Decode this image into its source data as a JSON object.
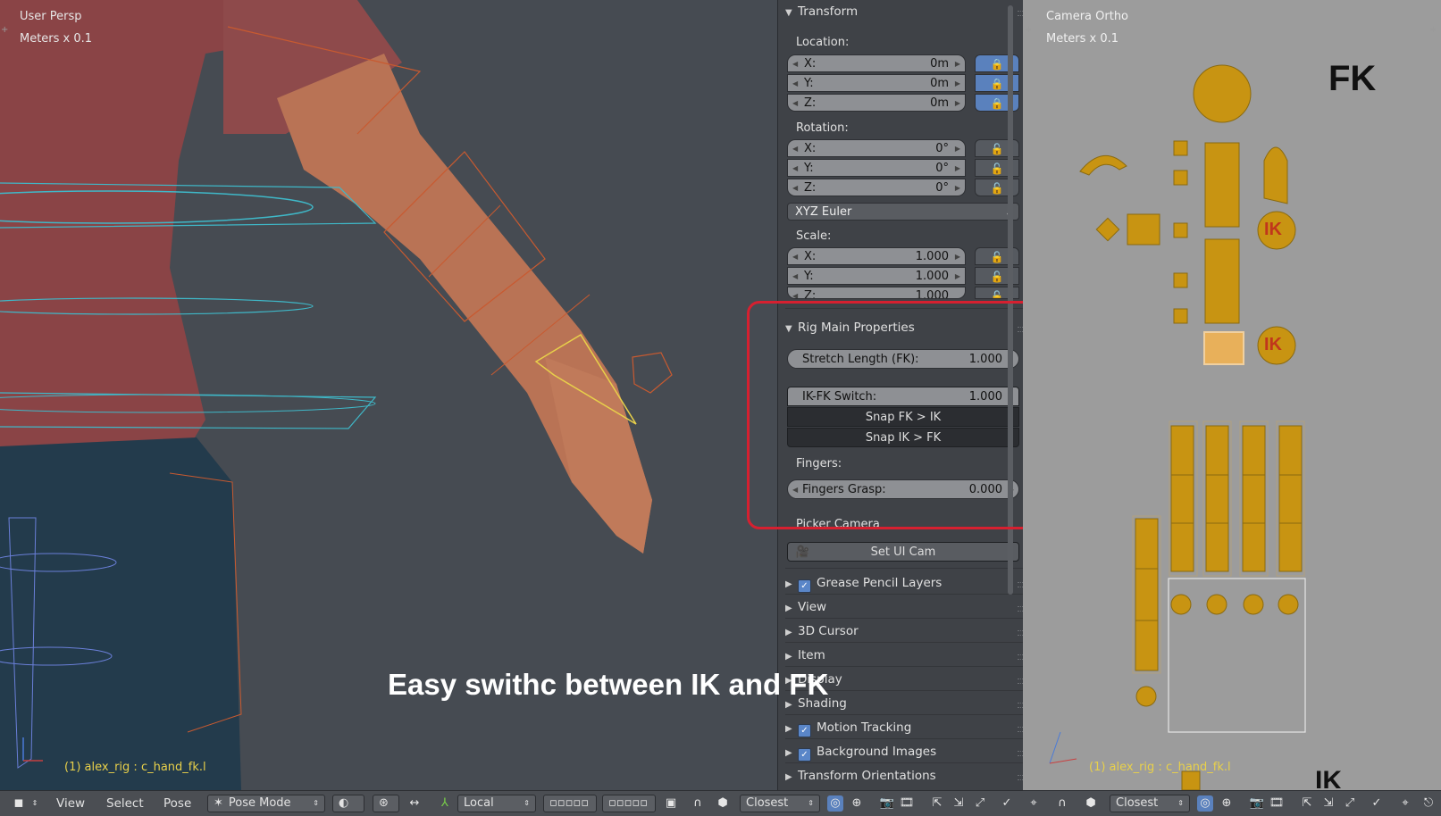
{
  "viewport": {
    "view_name": "User Persp",
    "units": "Meters x 0.1",
    "selected_bone": "(1) alex_rig : c_hand_fk.l"
  },
  "caption": "Easy swithc between IK and FK",
  "panel": {
    "transform": {
      "header": "Transform",
      "location_label": "Location:",
      "location": [
        {
          "axis": "X:",
          "value": "0m"
        },
        {
          "axis": "Y:",
          "value": "0m"
        },
        {
          "axis": "Z:",
          "value": "0m"
        }
      ],
      "rotation_label": "Rotation:",
      "rotation": [
        {
          "axis": "X:",
          "value": "0°"
        },
        {
          "axis": "Y:",
          "value": "0°"
        },
        {
          "axis": "Z:",
          "value": "0°"
        }
      ],
      "rotation_mode": "XYZ Euler",
      "scale_label": "Scale:",
      "scale": [
        {
          "axis": "X:",
          "value": "1.000"
        },
        {
          "axis": "Y:",
          "value": "1.000"
        },
        {
          "axis": "Z:",
          "value": "1.000"
        }
      ]
    },
    "rig_main": {
      "header": "Rig Main Properties",
      "stretch_label": "Stretch Length (FK):",
      "stretch_value": "1.000",
      "ikfk_label": "IK-FK Switch:",
      "ikfk_value": "1.000",
      "snap_fk_ik": "Snap FK > IK",
      "snap_ik_fk": "Snap IK > FK",
      "fingers_label": "Fingers:",
      "fingers_grasp_label": "Fingers Grasp:",
      "fingers_grasp_value": "0.000"
    },
    "picker_camera_label": "Picker Camera",
    "set_ui_cam": "Set UI Cam",
    "sections": [
      {
        "label": "Grease Pencil Layers",
        "checkbox": true
      },
      {
        "label": "View",
        "checkbox": false
      },
      {
        "label": "3D Cursor",
        "checkbox": false
      },
      {
        "label": "Item",
        "checkbox": false
      },
      {
        "label": "Display",
        "checkbox": false
      },
      {
        "label": "Shading",
        "checkbox": false
      },
      {
        "label": "Motion Tracking",
        "checkbox": true
      },
      {
        "label": "Background Images",
        "checkbox": true
      },
      {
        "label": "Transform Orientations",
        "checkbox": false
      }
    ]
  },
  "camera_view": {
    "view_name": "Camera Ortho",
    "units": "Meters x 0.1",
    "fk_label": "FK",
    "ik_badge": "IK",
    "ik_bottom_label": "IK",
    "selected_bone": "(1) alex_rig : c_hand_fk.l"
  },
  "bottom_bar": {
    "menu_view": "View",
    "menu_select": "Select",
    "menu_pose": "Pose",
    "mode": "Pose Mode",
    "orientation": "Local",
    "snap_target": "Closest",
    "snap_target_right": "Closest"
  },
  "colors": {
    "viewport_bg": "#464b52",
    "panel_bg": "#3f4247",
    "picker_gold": "#c89412",
    "highlight_red": "#d62030",
    "selected_text": "#e8d04a"
  }
}
